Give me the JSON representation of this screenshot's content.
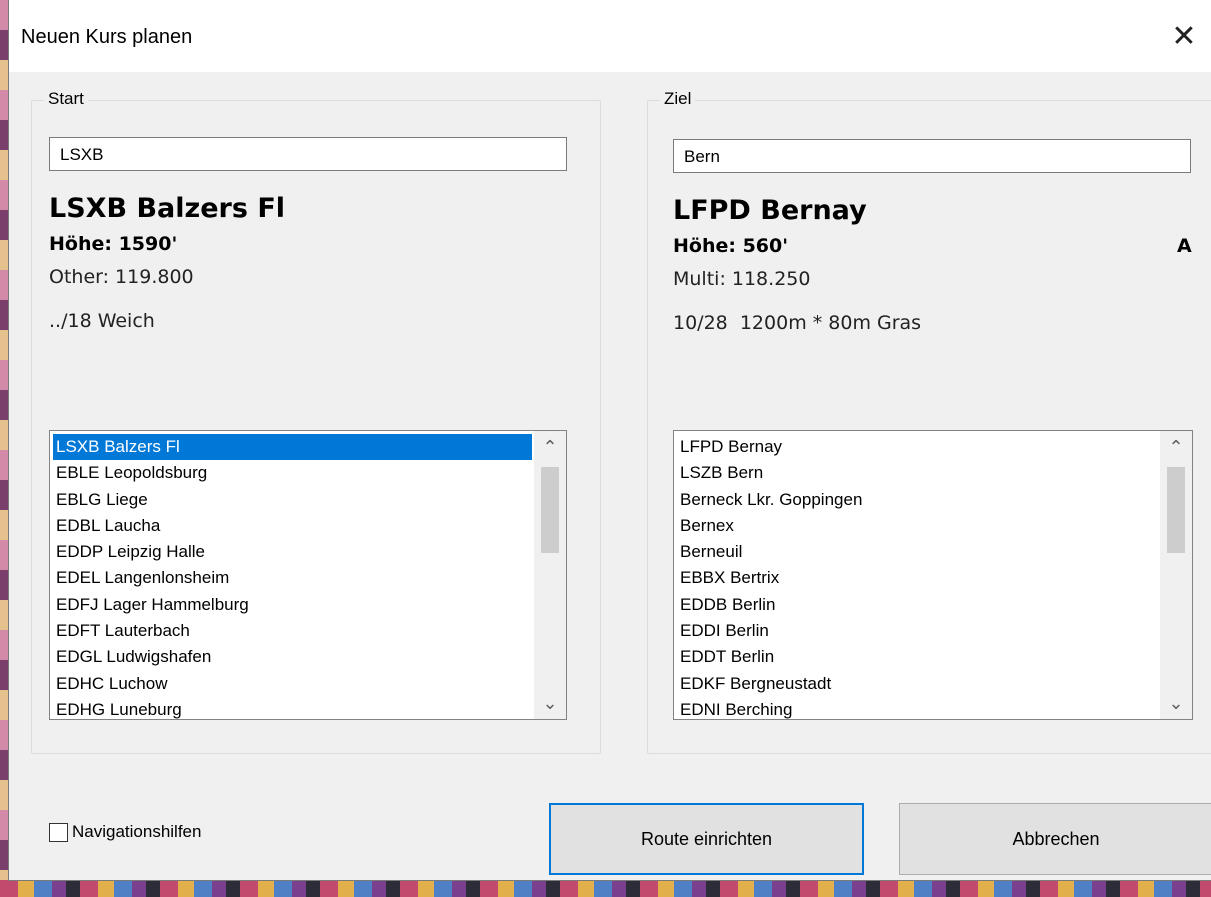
{
  "window": {
    "title": "Neuen Kurs planen",
    "close_glyph": "✕"
  },
  "start": {
    "legend": "Start",
    "search_value": "LSXB",
    "airport_name": "LSXB Balzers Fl",
    "height": "Höhe: 1590'",
    "class": "",
    "frequency": "Other: 119.800",
    "runway": "../18 Weich",
    "list": [
      "LSXB Balzers Fl",
      "EBLE Leopoldsburg",
      "EBLG Liege",
      "EDBL Laucha",
      "EDDP Leipzig Halle",
      "EDEL Langenlonsheim",
      "EDFJ Lager Hammelburg",
      "EDFT Lauterbach",
      "EDGL Ludwigshafen",
      "EDHC Luchow",
      "EDHG Luneburg"
    ],
    "selected_index": 0
  },
  "destination": {
    "legend": "Ziel",
    "search_value": "Bern",
    "airport_name": "LFPD Bernay",
    "height": "Höhe: 560'",
    "class": "A",
    "frequency": "Multi: 118.250",
    "runway": "10/28  1200m * 80m Gras",
    "list": [
      "LFPD Bernay",
      "LSZB Bern",
      "Berneck Lkr. Goppingen",
      "Bernex",
      "Berneuil",
      "EBBX Bertrix",
      "EDDB Berlin",
      "EDDI Berlin",
      "EDDT Berlin",
      "EDKF Bergneustadt",
      "EDNI Berching"
    ],
    "selected_index": -1
  },
  "options": {
    "navaids_label": "Navigationshilfen",
    "navaids_checked": false
  },
  "buttons": {
    "route_label": "Route einrichten",
    "cancel_label": "Abbrechen"
  },
  "icons": {
    "scroll_up": "chevron-up-icon",
    "scroll_down": "chevron-down-icon",
    "close": "close-icon"
  },
  "colors": {
    "selection": "#0078d7",
    "dialog_bg": "#f0f0f0"
  }
}
